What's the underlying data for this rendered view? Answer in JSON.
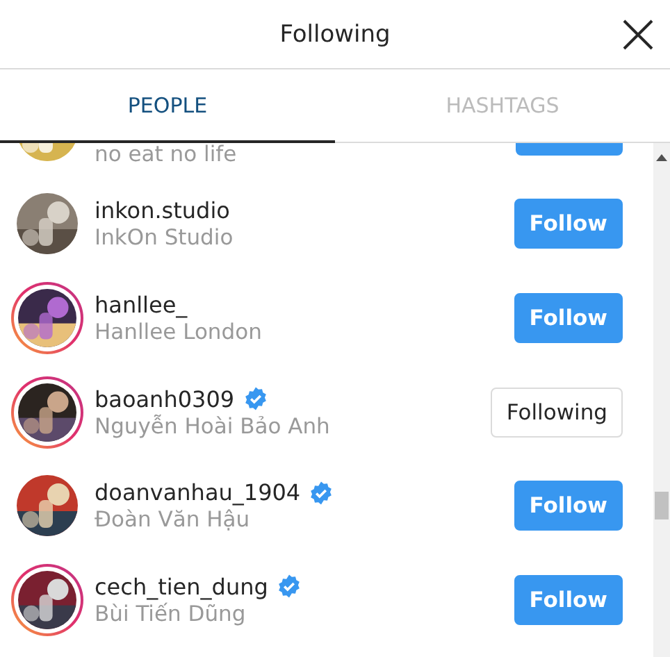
{
  "header": {
    "title": "Following"
  },
  "tabs": [
    {
      "label": "PEOPLE",
      "selected": true
    },
    {
      "label": "HASHTAGS",
      "selected": false
    }
  ],
  "clipped_row": {
    "full_name": "no eat no life"
  },
  "accounts": [
    {
      "username": "inkon.studio",
      "full_name": "InkOn Studio",
      "verified": false,
      "story_ring": false,
      "following": false,
      "button": "Follow"
    },
    {
      "username": "hanllee_",
      "full_name": "Hanllee London",
      "verified": false,
      "story_ring": true,
      "following": false,
      "button": "Follow"
    },
    {
      "username": "baoanh0309",
      "full_name": "Nguyễn Hoài Bảo Anh",
      "verified": true,
      "story_ring": true,
      "following": true,
      "button": "Following"
    },
    {
      "username": "doanvanhau_1904",
      "full_name": "Đoàn Văn Hậu",
      "verified": true,
      "story_ring": false,
      "following": false,
      "button": "Follow"
    },
    {
      "username": "cech_tien_dung",
      "full_name": "Bùi Tiến Dũng",
      "verified": true,
      "story_ring": true,
      "following": false,
      "button": "Follow"
    }
  ]
}
